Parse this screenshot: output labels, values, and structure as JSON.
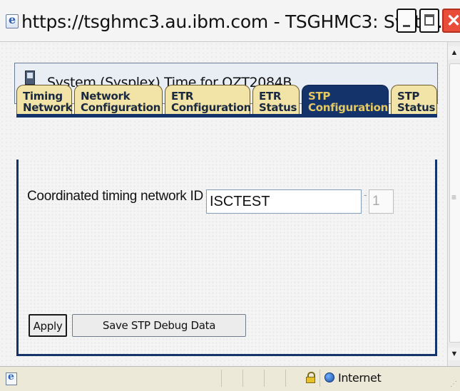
{
  "window": {
    "title": "https://tsghmc3.au.ibm.com - TSGHMC3: Syste..."
  },
  "header": {
    "title": "System (Sysplex) Time for OZT2084B"
  },
  "tabs": [
    {
      "line1": "Timing",
      "line2": "Network",
      "active": false
    },
    {
      "line1": "Network",
      "line2": "Configuration",
      "active": false
    },
    {
      "line1": "ETR",
      "line2": "Configuration",
      "active": false
    },
    {
      "line1": "ETR",
      "line2": "Status",
      "active": false
    },
    {
      "line1": "STP",
      "line2": "Configuration",
      "active": true
    },
    {
      "line1": "STP",
      "line2": "Status",
      "active": false
    }
  ],
  "form": {
    "ctn_label": "Coordinated timing network ID",
    "ctn_id_value": "ISCTEST",
    "separator": "-",
    "ctn_index_value": "1"
  },
  "buttons": {
    "apply": "Apply",
    "save_debug": "Save STP Debug Data"
  },
  "statusbar": {
    "zone": "Internet"
  },
  "colors": {
    "tab_active_bg": "#14336b",
    "tab_active_text": "#e4c861",
    "tab_inactive_bg": "#f2e4a6",
    "close_button": "#e94d3a"
  },
  "icons": [
    "ie-icon",
    "minimize-icon",
    "maximize-icon",
    "close-icon",
    "system-time-icon",
    "lock-icon",
    "globe-icon"
  ]
}
